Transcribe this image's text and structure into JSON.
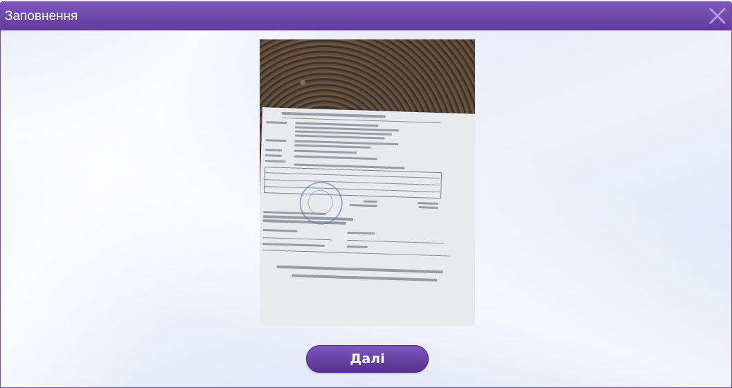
{
  "dialog": {
    "title": "Заповнення",
    "next_label": "Далі"
  },
  "icons": {
    "close": "close-icon",
    "photo": "document-photo"
  },
  "colors": {
    "titlebar": "#6b48aa",
    "button": "#6a47a8",
    "background": "#eef1fb"
  }
}
